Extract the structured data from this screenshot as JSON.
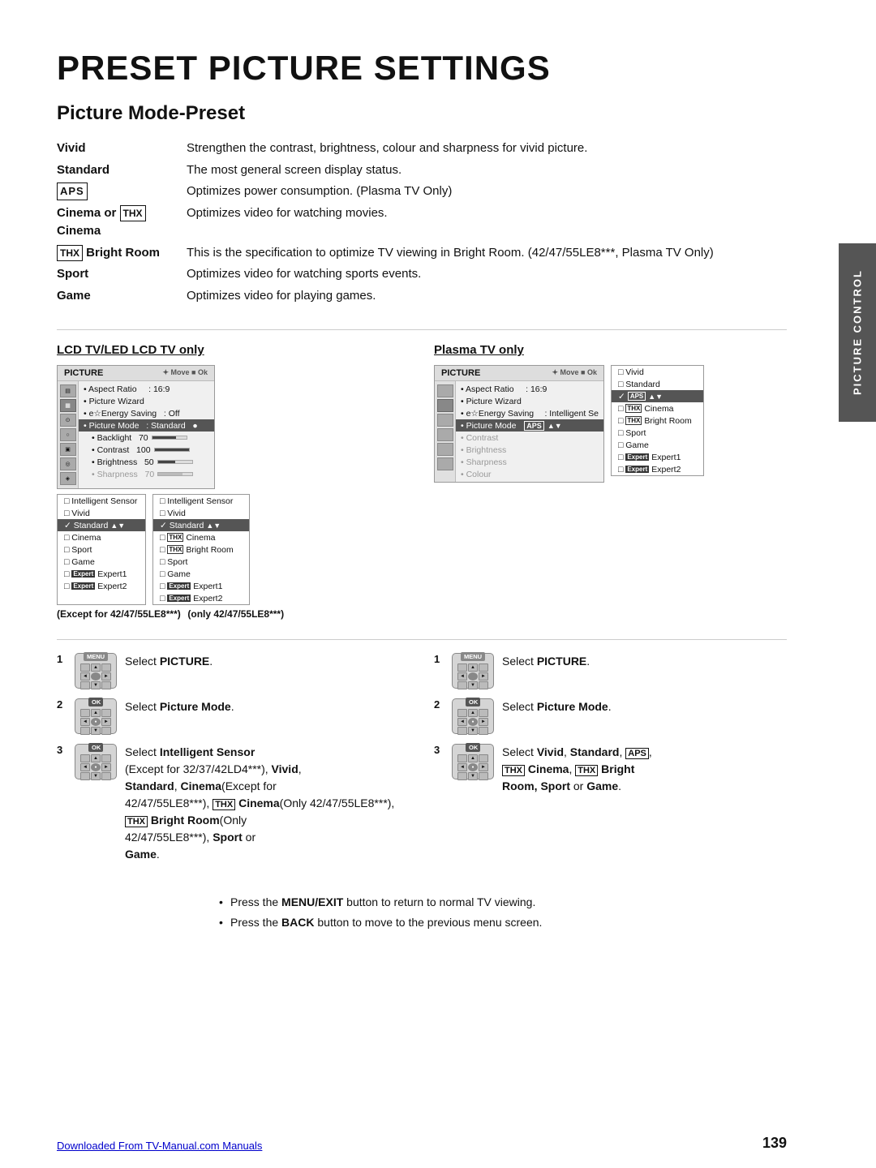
{
  "page": {
    "title": "PRESET PICTURE SETTINGS",
    "section_title": "Picture Mode-Preset"
  },
  "descriptions": [
    {
      "term": "Vivid",
      "def": "Strengthen the contrast, brightness, colour and sharpness for vivid picture.",
      "bold": true
    },
    {
      "term": "Standard",
      "def": "The most general screen display status.",
      "bold": true
    },
    {
      "term": "APS",
      "def": "Optimizes power consumption. (Plasma TV Only)",
      "is_aps": true
    },
    {
      "term": "Cinema_THX",
      "def": "Optimizes video for watching movies.",
      "is_cinema": true
    },
    {
      "term": "THX_Bright_Room",
      "def": "This is the specification to optimize TV viewing in Bright Room. (42/47/55LE8***, Plasma TV Only)",
      "is_thx_bright": true
    },
    {
      "term": "Sport",
      "def": "Optimizes video for watching sports events.",
      "bold": true
    },
    {
      "term": "Game",
      "def": "Optimizes video for playing games.",
      "bold": true
    }
  ],
  "lcd_panel": {
    "title": "LCD TV/LED LCD TV only",
    "header": "PICTURE",
    "items": [
      {
        "label": "• Aspect Ratio",
        "value": ": 16:9"
      },
      {
        "label": "• Picture Wizard",
        "value": ""
      },
      {
        "label": "• e☆Energy Saving",
        "value": ": Off"
      },
      {
        "label": "• Picture Mode",
        "value": ": Standard",
        "highlighted": true
      },
      {
        "label": "• Backlight",
        "value": "70",
        "has_bar": true,
        "bar_pct": 70
      },
      {
        "label": "• Contrast",
        "value": "100",
        "has_bar": true,
        "bar_pct": 100
      },
      {
        "label": "• Brightness",
        "value": "50",
        "has_bar": true,
        "bar_pct": 50
      },
      {
        "label": "• Sharpness",
        "value": "70",
        "has_bar": true,
        "bar_pct": 70
      }
    ]
  },
  "lcd_submenu_left": {
    "items": [
      {
        "label": "Intelligent Sensor",
        "checked": false
      },
      {
        "label": "Vivid",
        "checked": false
      },
      {
        "label": "✓ Standard",
        "checked": true,
        "selected": true
      },
      {
        "label": "Cinema",
        "checked": false
      },
      {
        "label": "Sport",
        "checked": false
      },
      {
        "label": "Game",
        "checked": false
      },
      {
        "label": "▪ Expert1",
        "checked": false
      },
      {
        "label": "▪ Expert2",
        "checked": false
      }
    ]
  },
  "lcd_submenu_right": {
    "items": [
      {
        "label": "Intelligent Sensor",
        "checked": false
      },
      {
        "label": "Vivid",
        "checked": false
      },
      {
        "label": "✓ Standard",
        "checked": true,
        "selected": true
      },
      {
        "label": "THX Cinema",
        "checked": false,
        "thx": true
      },
      {
        "label": "THX Bright Room",
        "checked": false,
        "thx": true
      },
      {
        "label": "Sport",
        "checked": false
      },
      {
        "label": "Game",
        "checked": false
      },
      {
        "label": "▪ Expert1",
        "checked": false
      },
      {
        "label": "▪ Expert2",
        "checked": false
      }
    ]
  },
  "plasma_panel": {
    "title": "Plasma TV only",
    "header": "PICTURE",
    "items": [
      {
        "label": "• Aspect Ratio",
        "value": ": 16:9"
      },
      {
        "label": "• Picture Wizard",
        "value": ""
      },
      {
        "label": "• e☆Energy Saving",
        "value": ": Intelligent Se",
        "highlighted": false
      },
      {
        "label": "• Picture Mode",
        "value": "APS",
        "highlighted": true,
        "is_aps": true
      },
      {
        "label": "• Contrast",
        "value": ""
      },
      {
        "label": "• Brightness",
        "value": ""
      },
      {
        "label": "• Sharpness",
        "value": ""
      },
      {
        "label": "• Colour",
        "value": ""
      }
    ],
    "submenu": [
      {
        "label": "Vivid",
        "checked": false
      },
      {
        "label": "Standard",
        "checked": false
      },
      {
        "label": "APS",
        "checked": true,
        "selected": true,
        "is_aps": true
      },
      {
        "label": "THX Cinema",
        "checked": false,
        "thx": true
      },
      {
        "label": "THX Bright Room",
        "checked": false,
        "thx": true
      },
      {
        "label": "Sport",
        "checked": false
      },
      {
        "label": "Game",
        "checked": false
      },
      {
        "label": "▪ Expert1",
        "checked": false
      },
      {
        "label": "▪ Expert2",
        "checked": false
      }
    ]
  },
  "captions": {
    "lcd_left": "(Except for 42/47/55LE8***)",
    "lcd_right": "(only 42/47/55LE8***)"
  },
  "steps_lcd": [
    {
      "number": "1",
      "remote": "MENU",
      "desc": "Select PICTURE.",
      "bold_word": "PICTURE"
    },
    {
      "number": "2",
      "remote": "OK",
      "desc": "Select Picture Mode.",
      "bold_phrase": "Picture Mode"
    },
    {
      "number": "3",
      "remote": "OK",
      "desc": "Select Intelligent Sensor (Except for 32/37/42LD4***), Vivid, Standard, Cinema(Except for 42/47/55LE8***), THX Cinema(Only 42/47/55LE8***), THX Bright Room(Only 42/47/55LE8***), Sport or Game.",
      "complex": true
    }
  ],
  "steps_plasma": [
    {
      "number": "1",
      "remote": "MENU",
      "desc": "Select PICTURE.",
      "bold_word": "PICTURE"
    },
    {
      "number": "2",
      "remote": "OK",
      "desc": "Select Picture Mode.",
      "bold_phrase": "Picture Mode"
    },
    {
      "number": "3",
      "remote": "OK",
      "desc": "Select Vivid, Standard, APS, THX Cinema, THX Bright Room, Sport or Game.",
      "complex": true
    }
  ],
  "notes": [
    "Press the MENU/EXIT button to return to normal TV viewing.",
    "Press the BACK button to move to the previous menu screen."
  ],
  "footer": {
    "link": "Downloaded From TV-Manual.com Manuals",
    "page": "139"
  },
  "sidebar": {
    "label": "PICTURE CONTROL"
  }
}
